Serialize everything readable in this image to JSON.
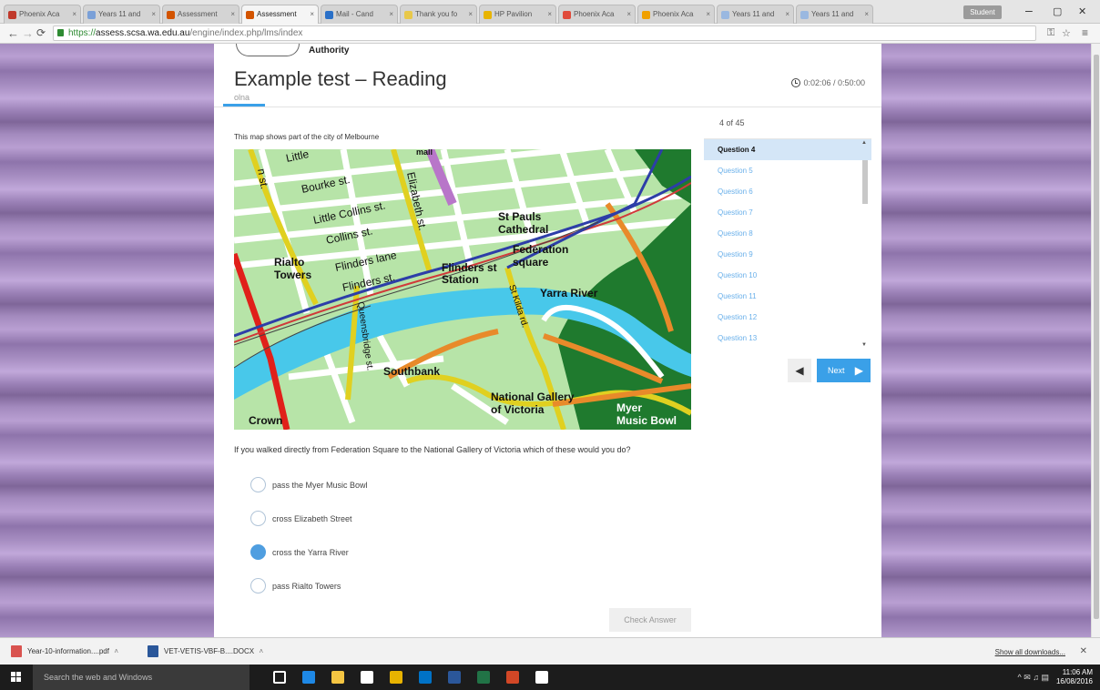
{
  "browser": {
    "tabs": [
      {
        "label": "Phoenix Aca",
        "color": "#c0392b"
      },
      {
        "label": "Years 11 and",
        "color": "#7aa0d8"
      },
      {
        "label": "Assessment",
        "color": "#d35400"
      },
      {
        "label": "Assessment",
        "color": "#d35400",
        "active": true
      },
      {
        "label": "Mail - Cand",
        "color": "#2a70c8"
      },
      {
        "label": "Thank you fo",
        "color": "#e8c84a"
      },
      {
        "label": "HP Pavilion",
        "color": "#e8b400"
      },
      {
        "label": "Phoenix Aca",
        "color": "#e04a3a"
      },
      {
        "label": "Phoenix Aca",
        "color": "#f0a000"
      },
      {
        "label": "Years 11 and",
        "color": "#9ab8e0"
      },
      {
        "label": "Years 11 and",
        "color": "#9ab8e0"
      }
    ],
    "profile_label": "Student",
    "window_controls": [
      "–",
      "▢",
      "✕"
    ],
    "url_scheme": "https://",
    "url_host": "assess.scsa.wa.edu.au",
    "url_path": "/engine/index.php/lms/index"
  },
  "header": {
    "org_word": "Authority",
    "title": "Example test – Reading",
    "username": "olna",
    "timer": "0:02:06 / 0:50:00"
  },
  "nav": {
    "count": "4 of 45",
    "questions": [
      "Question 4",
      "Question 5",
      "Question 6",
      "Question 7",
      "Question 8",
      "Question 9",
      "Question 10",
      "Question 11",
      "Question 12",
      "Question 13"
    ],
    "current_index": 0,
    "next_label": "Next"
  },
  "content": {
    "stem": "This map shows part of the city of Melbourne",
    "question": "If you walked directly from Federation Square to the National Gallery of Victoria which of these would you do?",
    "options": [
      {
        "label": "pass the Myer Music Bowl",
        "selected": false
      },
      {
        "label": "cross Elizabeth Street",
        "selected": false
      },
      {
        "label": "cross the Yarra River",
        "selected": true
      },
      {
        "label": "pass Rialto Towers",
        "selected": false
      }
    ],
    "check_label": "Check Answer"
  },
  "map_labels": {
    "little": "Little",
    "mall": "mall",
    "st": "n st.",
    "bourke": "Bourke st.",
    "little_collins": "Little Collins st.",
    "collins": "Collins st.",
    "flinders_lane": "Flinders lane",
    "flinders": "Flinders st.",
    "rialto1": "Rialto",
    "rialto2": "Towers",
    "elizabeth": "Elizabeth st.",
    "station1": "Flinders st",
    "station2": "Station",
    "stpauls1": "St Pauls",
    "stpauls2": "Cathedral",
    "fed1": "Federation",
    "fed2": "square",
    "yarra": "Yarra River",
    "stkilda": "St Kilda rd.",
    "queensbridge": "Queensbridge st.",
    "southbank": "Southbank",
    "ngv1": "National Gallery",
    "ngv2": "of Victoria",
    "myer1": "Myer",
    "myer2": "Music Bowl",
    "crown": "Crown"
  },
  "downloads": {
    "items": [
      {
        "label": "Year-10-information....pdf",
        "color": "#d9534f"
      },
      {
        "label": "VET-VETIS-VBF-B....DOCX",
        "color": "#2b579a"
      }
    ],
    "show_all": "Show all downloads...",
    "close": "✕"
  },
  "taskbar": {
    "search_placeholder": "Search the web and Windows",
    "apps": [
      "task-view",
      "edge",
      "file-explorer",
      "store",
      "chrome",
      "outlook",
      "word",
      "excel",
      "powerpoint",
      "photos"
    ],
    "app_colors": [
      "#ffffff",
      "#1e88e5",
      "#f4c542",
      "#ffffff",
      "#e8b300",
      "#0072c6",
      "#2b579a",
      "#217346",
      "#d24726",
      "#ffffff"
    ],
    "time": "11:06 AM",
    "date": "16/08/2016"
  }
}
